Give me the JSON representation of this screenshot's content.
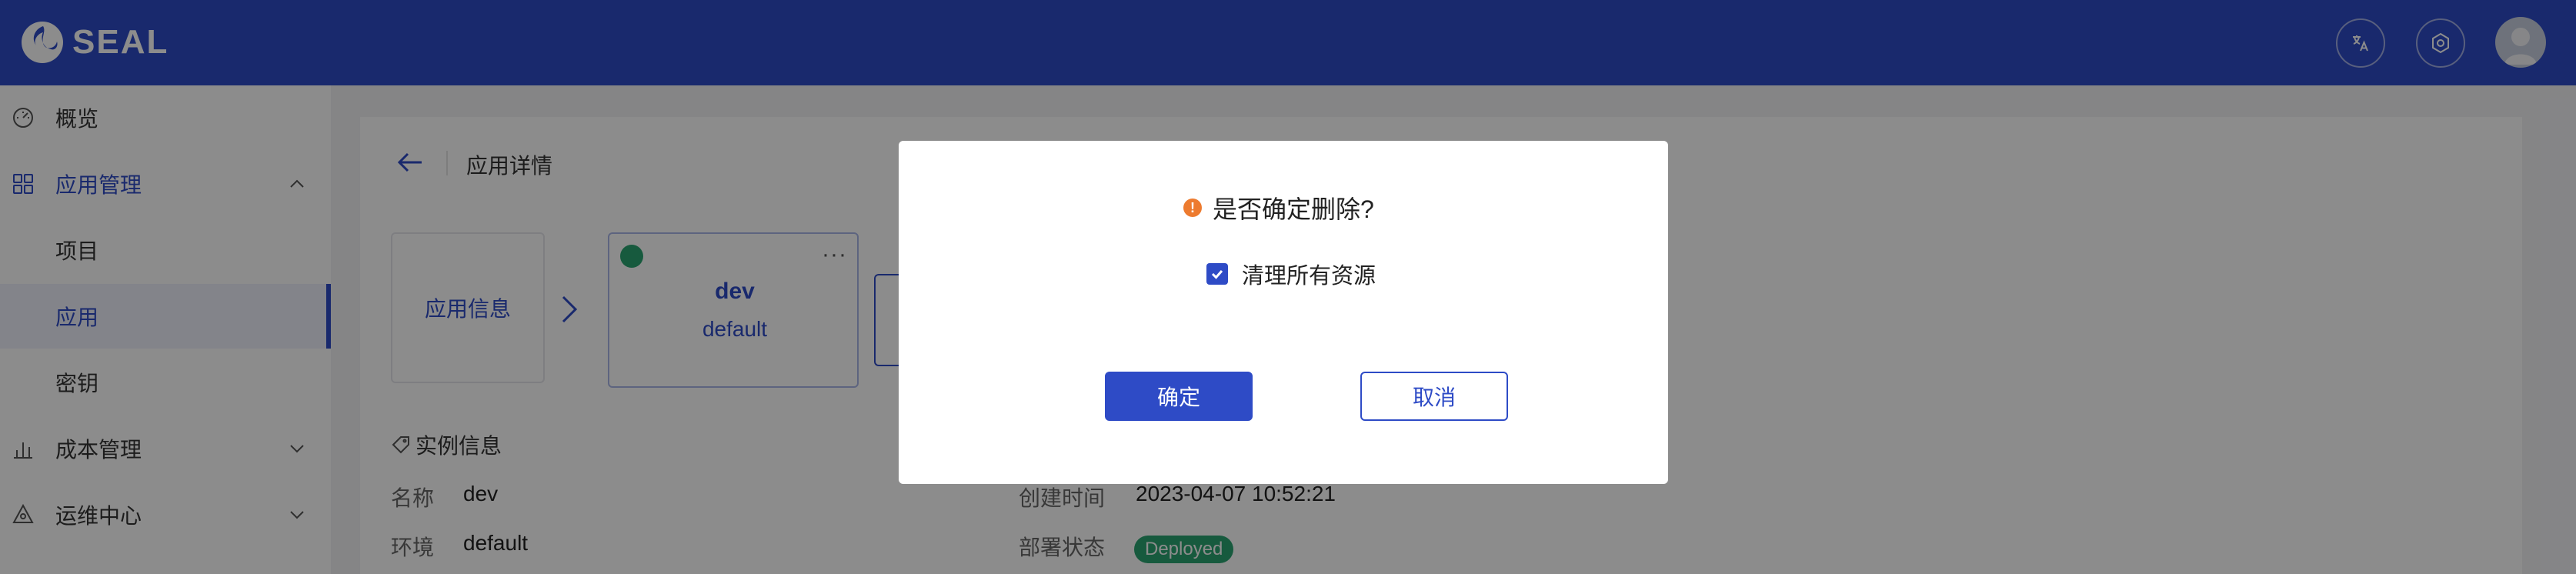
{
  "brand": {
    "name": "SEAL"
  },
  "header": {
    "actions": [
      {
        "icon": "translate-icon"
      },
      {
        "icon": "gear-icon"
      },
      {
        "icon": "avatar"
      }
    ]
  },
  "sidebar": {
    "items": [
      {
        "label": "概览",
        "icon": "dashboard-icon"
      },
      {
        "label": "应用管理",
        "icon": "grid-icon",
        "expanded": true
      },
      {
        "label": "项目"
      },
      {
        "label": "应用",
        "active": true
      },
      {
        "label": "密钥"
      },
      {
        "label": "成本管理",
        "icon": "bar-chart-icon",
        "expanded": false
      },
      {
        "label": "运维中心",
        "icon": "ops-icon",
        "expanded": false
      }
    ]
  },
  "page": {
    "breadcrumb": "应用详情",
    "app_info_card": "应用信息",
    "env_card": {
      "name": "dev",
      "namespace": "default",
      "status_color": "#2ba471",
      "more": "···"
    },
    "section_title": "实例信息",
    "fields": {
      "name_label": "名称",
      "name_value": "dev",
      "env_label": "环境",
      "env_value": "default",
      "created_label": "创建时间",
      "created_value": "2023-04-07 10:52:21",
      "deploy_label": "部署状态",
      "deploy_value": "Deployed"
    }
  },
  "modal": {
    "title": "是否确定删除?",
    "warn_glyph": "!",
    "checkbox_label": "清理所有资源",
    "checkbox_checked": true,
    "confirm_label": "确定",
    "cancel_label": "取消"
  },
  "colors": {
    "primary": "#2e4bc6",
    "success": "#2ba471",
    "warning": "#ed7b2f"
  }
}
